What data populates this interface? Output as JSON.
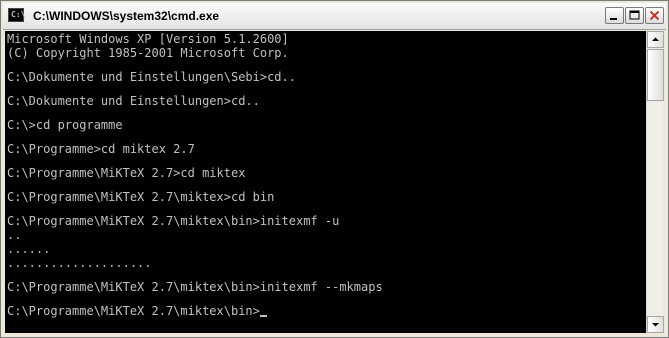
{
  "window": {
    "title": "C:\\WINDOWS\\system32\\cmd.exe",
    "icon_glyph": "C:\\"
  },
  "controls": {
    "minimize_icon": "minimize-icon",
    "maximize_icon": "maximize-icon",
    "close_icon": "close-icon"
  },
  "terminal": {
    "blocks": [
      [
        "Microsoft Windows XP [Version 5.1.2600]",
        "(C) Copyright 1985-2001 Microsoft Corp."
      ],
      [
        "C:\\Dokumente und Einstellungen\\Sebi>cd.."
      ],
      [
        "C:\\Dokumente und Einstellungen>cd.."
      ],
      [
        "C:\\>cd programme"
      ],
      [
        "C:\\Programme>cd miktex 2.7"
      ],
      [
        "C:\\Programme\\MiKTeX 2.7>cd miktex"
      ],
      [
        "C:\\Programme\\MiKTeX 2.7\\miktex>cd bin"
      ],
      [
        "C:\\Programme\\MiKTeX 2.7\\miktex\\bin>initexmf -u",
        "..",
        "......",
        "...................."
      ],
      [
        "C:\\Programme\\MiKTeX 2.7\\miktex\\bin>initexmf --mkmaps"
      ]
    ],
    "prompt": "C:\\Programme\\MiKTeX 2.7\\miktex\\bin>"
  },
  "colors": {
    "terminal_bg": "#000000",
    "terminal_fg": "#c0c0c0",
    "close_red": "#c0392b"
  }
}
